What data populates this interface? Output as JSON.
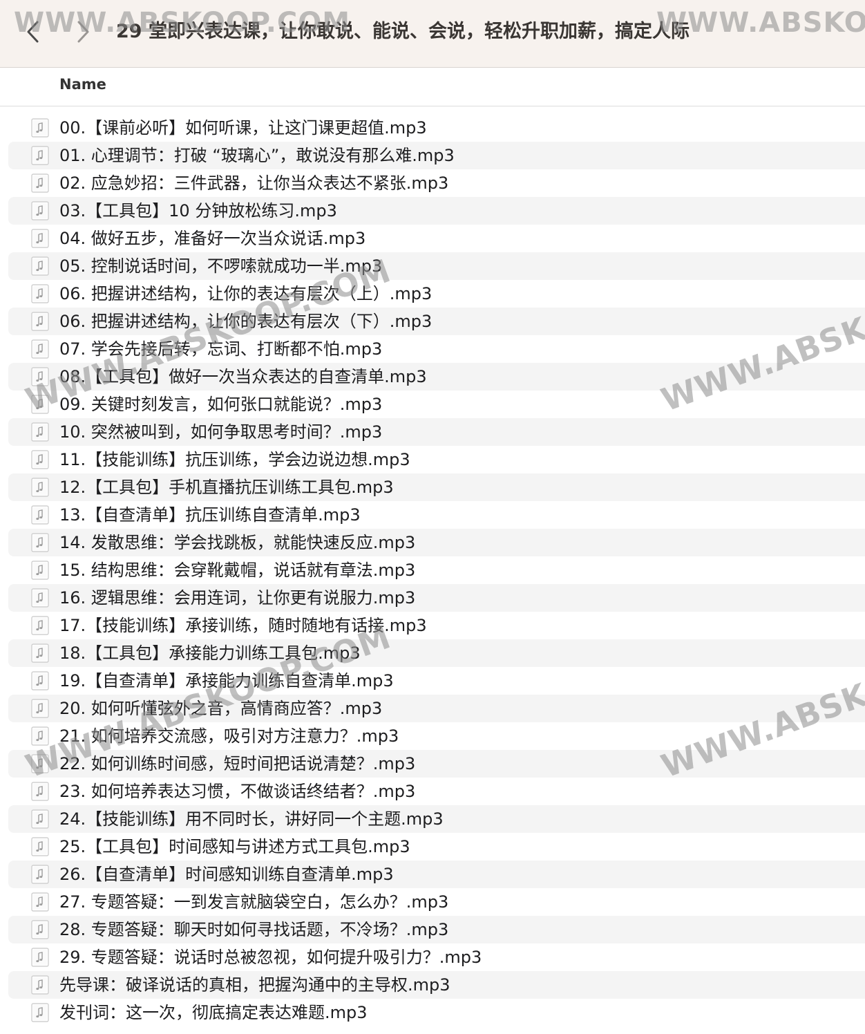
{
  "toolbar": {
    "back_icon": "chevron-left-icon",
    "forward_icon": "chevron-right-icon",
    "title": "29 堂即兴表达课，让你敢说、能说、会说，轻松升职加薪，搞定人际"
  },
  "columns": {
    "name": "Name"
  },
  "file_icon": "audio-file-icon",
  "files": [
    {
      "name": "00.【课前必听】如何听课，让这门课更超值.mp3"
    },
    {
      "name": "01. 心理调节：打破 “玻璃心”，敢说没有那么难.mp3"
    },
    {
      "name": "02. 应急妙招：三件武器，让你当众表达不紧张.mp3"
    },
    {
      "name": "03.【工具包】10 分钟放松练习.mp3"
    },
    {
      "name": "04. 做好五步，准备好一次当众说话.mp3"
    },
    {
      "name": "05. 控制说话时间，不啰嗦就成功一半.mp3"
    },
    {
      "name": "06. 把握讲述结构，让你的表达有层次（上）.mp3"
    },
    {
      "name": "06. 把握讲述结构，让你的表达有层次（下）.mp3"
    },
    {
      "name": "07. 学会先接后转，忘词、打断都不怕.mp3"
    },
    {
      "name": "08.【工具包】做好一次当众表达的自查清单.mp3"
    },
    {
      "name": "09. 关键时刻发言，如何张口就能说？.mp3"
    },
    {
      "name": "10. 突然被叫到，如何争取思考时间？.mp3"
    },
    {
      "name": "11.【技能训练】抗压训练，学会边说边想.mp3"
    },
    {
      "name": "12.【工具包】手机直播抗压训练工具包.mp3"
    },
    {
      "name": "13.【自查清单】抗压训练自查清单.mp3"
    },
    {
      "name": "14. 发散思维：学会找跳板，就能快速反应.mp3"
    },
    {
      "name": "15. 结构思维：会穿靴戴帽，说话就有章法.mp3"
    },
    {
      "name": "16. 逻辑思维：会用连词，让你更有说服力.mp3"
    },
    {
      "name": "17.【技能训练】承接训练，随时随地有话接.mp3"
    },
    {
      "name": "18.【工具包】承接能力训练工具包.mp3"
    },
    {
      "name": "19.【自查清单】承接能力训练自查清单.mp3"
    },
    {
      "name": "20. 如何听懂弦外之音，高情商应答？.mp3"
    },
    {
      "name": "21. 如何培养交流感，吸引对方注意力？.mp3"
    },
    {
      "name": "22. 如何训练时间感，短时间把话说清楚？.mp3"
    },
    {
      "name": "23. 如何培养表达习惯，不做谈话终结者？.mp3"
    },
    {
      "name": "24.【技能训练】用不同时长，讲好同一个主题.mp3"
    },
    {
      "name": "25.【工具包】时间感知与讲述方式工具包.mp3"
    },
    {
      "name": "26.【自查清单】时间感知训练自查清单.mp3"
    },
    {
      "name": "27. 专题答疑：一到发言就脑袋空白，怎么办？.mp3"
    },
    {
      "name": "28. 专题答疑：聊天时如何寻找话题，不冷场？.mp3"
    },
    {
      "name": "29. 专题答疑：说话时总被忽视，如何提升吸引力？.mp3"
    },
    {
      "name": "先导课：破译说话的真相，把握沟通中的主导权.mp3"
    },
    {
      "name": "发刊词：这一次，彻底搞定表达难题.mp3"
    }
  ],
  "watermark": {
    "text": "WWW.ABSKOOP.COM"
  }
}
